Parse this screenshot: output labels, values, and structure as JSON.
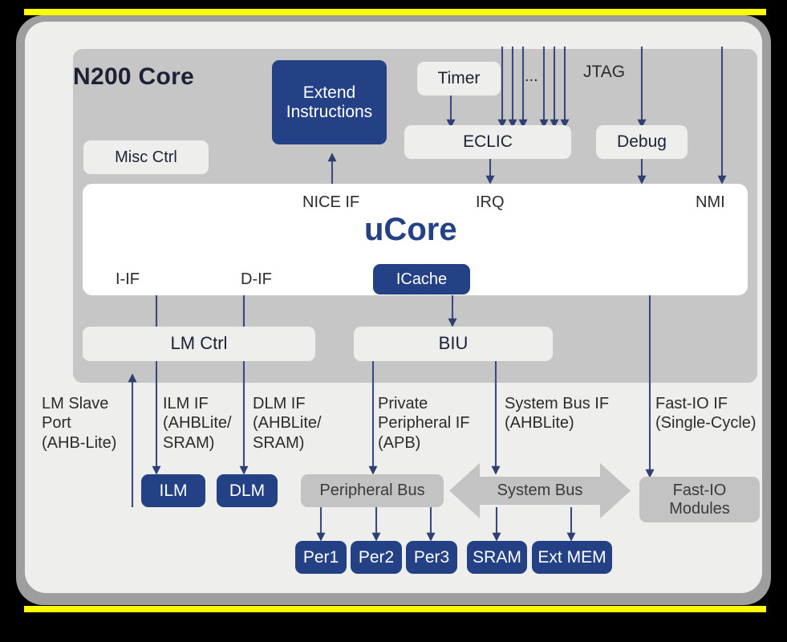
{
  "diagram": {
    "title": "N200 Core",
    "core_title": "uCore",
    "colors": {
      "accent_blue": "#244185",
      "panel_gray": "#c6c6c6",
      "canvas": "#eeeeed",
      "frame": "#9e9e9e",
      "highlight": "#ffff00",
      "wire": "#3a4a80",
      "bus_gray": "#c3c3c3"
    }
  },
  "blocks": {
    "extend_instructions": "Extend\nInstructions",
    "misc_ctrl": "Misc Ctrl",
    "timer": "Timer",
    "eclic": "ECLIC",
    "debug": "Debug",
    "icache": "ICache",
    "lm_ctrl": "LM Ctrl",
    "biu": "BIU",
    "ilm": "ILM",
    "dlm": "DLM",
    "peripheral_bus": "Peripheral Bus",
    "system_bus": "System Bus",
    "fast_io_modules": "Fast-IO\nModules",
    "per1": "Per1",
    "per2": "Per2",
    "per3": "Per3",
    "sram": "SRAM",
    "ext_mem": "Ext MEM"
  },
  "signal_labels": {
    "ellipsis": "...",
    "jtag": "JTAG",
    "nice_if": "NICE IF",
    "irq": "IRQ",
    "nmi": "NMI",
    "i_if": "I-IF",
    "d_if": "D-IF"
  },
  "interface_labels": {
    "lm_slave_port": "LM Slave\nPort\n(AHB-Lite)",
    "ilm_if": "ILM IF\n(AHBLite/\nSRAM)",
    "dlm_if": "DLM IF\n(AHBLite/\nSRAM)",
    "private_peripheral_if": "Private\n Peripheral IF\n(APB)",
    "system_bus_if": "System Bus IF\n(AHBLite)",
    "fast_io_if": "Fast-IO IF\n(Single-Cycle)"
  }
}
